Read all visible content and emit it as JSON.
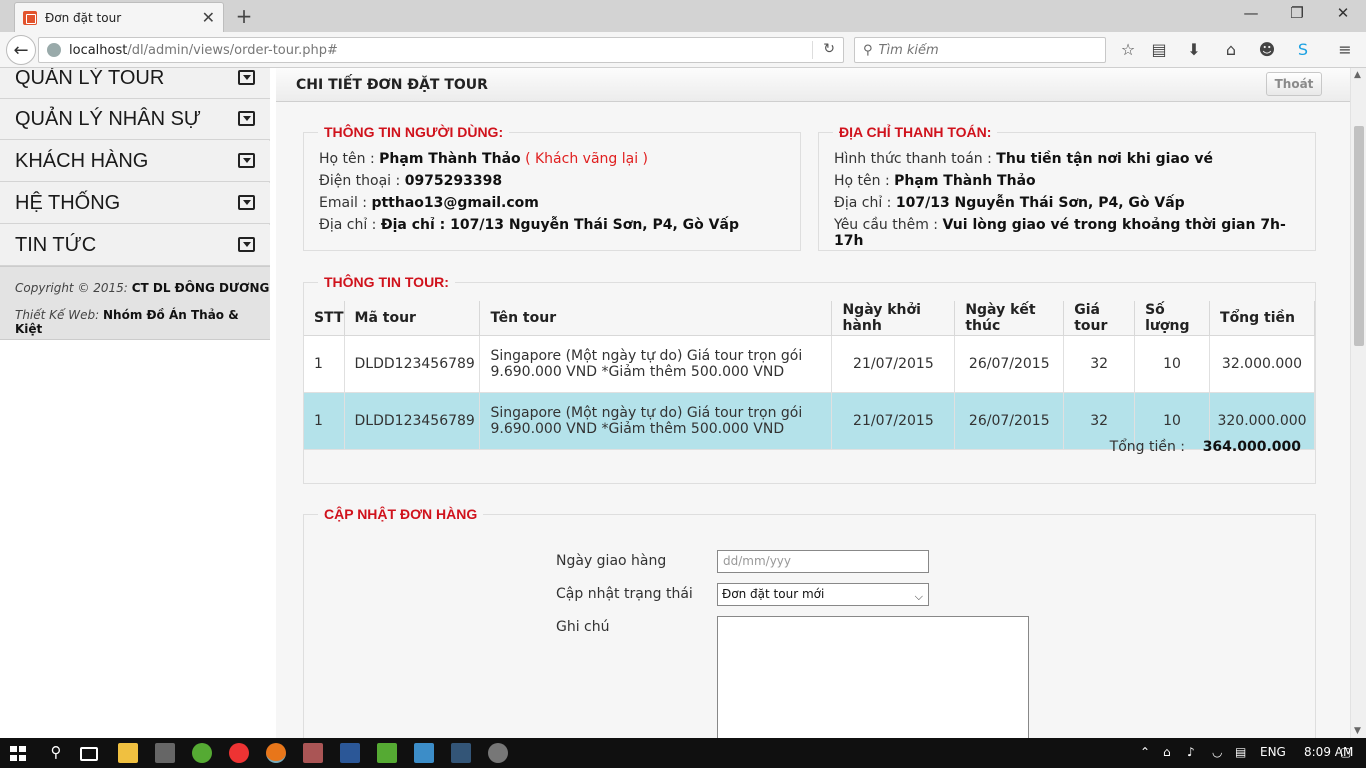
{
  "browser": {
    "tab_title": "Đơn đặt tour",
    "url_host": "localhost",
    "url_path": "/dl/admin/views/order-tour.php#",
    "search_placeholder": "Tìm kiếm"
  },
  "sidebar": {
    "items": [
      {
        "label": "QUẢN LÝ TOUR"
      },
      {
        "label": "QUẢN LÝ NHÂN SỰ"
      },
      {
        "label": "KHÁCH HÀNG"
      },
      {
        "label": "HỆ THỐNG"
      },
      {
        "label": "TIN TỨC"
      }
    ],
    "copyright_prefix": "Copyright © 2015:",
    "copyright_company": "CT DL ĐÔNG DƯƠNG",
    "design_prefix": "Thiết Kế Web:",
    "design_team": "Nhóm Đồ Án Thảo & Kiệt"
  },
  "header": {
    "title": "CHI TIẾT ĐƠN ĐẶT TOUR",
    "logout_label": "Thoát"
  },
  "user_info": {
    "legend": "THÔNG TIN NGƯỜI DÙNG:",
    "name_label": "Họ tên :",
    "name_value": "Phạm Thành Thảo",
    "guest_note": "( Khách vãng lại )",
    "phone_label": "Điện thoại :",
    "phone_value": "0975293398",
    "email_label": "Email :",
    "email_value": "ptthao13@gmail.com",
    "address_label": "Địa chỉ :",
    "address_value": "Địa chỉ : 107/13 Nguyễn Thái Sơn, P4, Gò Vấp"
  },
  "payment": {
    "legend": "ĐỊA CHỈ THANH TOÁN:",
    "method_label": "Hình thức thanh toán :",
    "method_value": "Thu tiền tận nơi khi giao vé",
    "name_label": "Họ tên :",
    "name_value": "Phạm Thành Thảo",
    "address_label": "Địa chỉ :",
    "address_value": "107/13 Nguyễn Thái Sơn, P4, Gò Vấp",
    "request_label": "Yêu cầu thêm :",
    "request_value": "Vui lòng giao vé trong khoảng thời gian 7h-17h"
  },
  "tour_info": {
    "legend": "THÔNG TIN TOUR:",
    "columns": [
      "STT",
      "Mã tour",
      "Tên tour",
      "Ngày khởi hành",
      "Ngày kết thúc",
      "Giá tour",
      "Số lượng",
      "Tổng tiền"
    ],
    "rows": [
      {
        "stt": "1",
        "code": "DLDD123456789",
        "name_line1": "Singapore (Một ngày tự do) Giá tour trọn gói",
        "name_line2": "9.690.000 VND *Giảm thêm 500.000 VND",
        "start": "21/07/2015",
        "end": "26/07/2015",
        "price": "32",
        "qty": "10",
        "total": "32.000.000"
      },
      {
        "stt": "1",
        "code": "DLDD123456789",
        "name_line1": "Singapore (Một ngày tự do) Giá tour trọn gói",
        "name_line2": "9.690.000 VND *Giảm thêm 500.000 VND",
        "start": "21/07/2015",
        "end": "26/07/2015",
        "price": "32",
        "qty": "10",
        "total": "320.000.000"
      }
    ],
    "total_label": "Tổng tiền :",
    "total_value": "364.000.000"
  },
  "update": {
    "legend": "CẬP NHẬT ĐƠN HÀNG",
    "delivery_label": "Ngày giao hàng",
    "delivery_placeholder": "dd/mm/yyy",
    "status_label": "Cập nhật trạng thái",
    "status_value": "Đơn đặt tour mới",
    "note_label": "Ghi chú"
  },
  "taskbar": {
    "language": "ENG",
    "time": "8:09 AM"
  }
}
